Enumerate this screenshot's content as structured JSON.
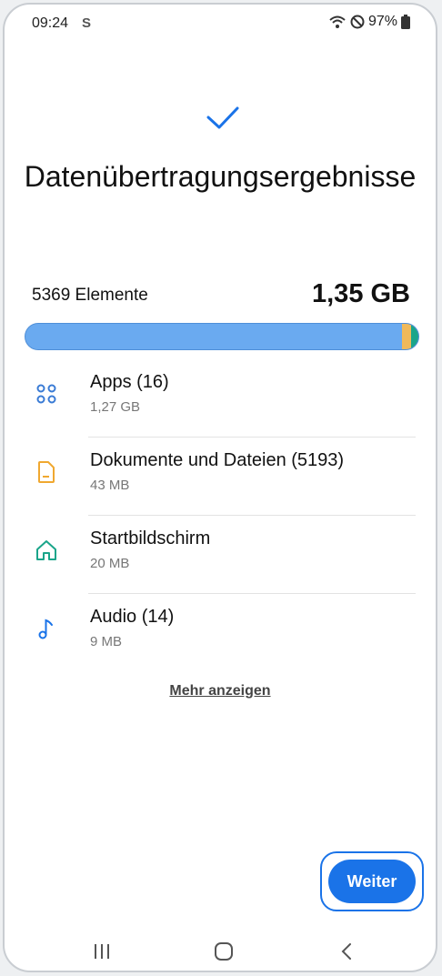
{
  "status_bar": {
    "time": "09:24",
    "app_icon": "S",
    "battery": "97%"
  },
  "header": {
    "title": "Datenübertragungsergebnisse"
  },
  "summary": {
    "count_label": "5369 Elemente",
    "total_size": "1,35 GB"
  },
  "usage_bar": {
    "segments_pct": {
      "apps": 94,
      "documents": 3,
      "home": 1.5,
      "audio": 1.5
    }
  },
  "items": [
    {
      "label": "Apps (16)",
      "size": "1,27 GB",
      "icon": "apps-icon",
      "color": "#3a7bd5"
    },
    {
      "label": "Dokumente und Dateien (5193)",
      "size": "43 MB",
      "icon": "document-icon",
      "color": "#f0a830"
    },
    {
      "label": "Startbildschirm",
      "size": "20 MB",
      "icon": "home-icon",
      "color": "#1aa58a"
    },
    {
      "label": "Audio (14)",
      "size": "9 MB",
      "icon": "music-note-icon",
      "color": "#1a73e8"
    }
  ],
  "more_link": "Mehr anzeigen",
  "next_button": "Weiter",
  "colors": {
    "accent": "#1a73e8",
    "bar": "#6aaaf0"
  }
}
